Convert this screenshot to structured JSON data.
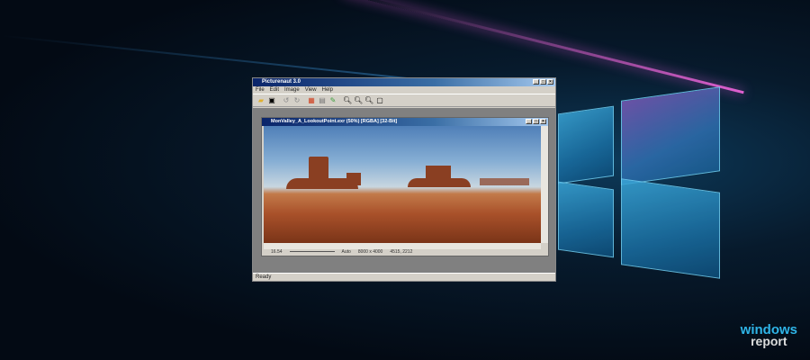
{
  "app": {
    "title": "Picturenaut 3.0",
    "menu": [
      "File",
      "Edit",
      "Image",
      "View",
      "Help"
    ],
    "toolbar": [
      "open-icon",
      "save-icon",
      "undo-icon",
      "redo-icon",
      "hdr-icon",
      "tonemap-icon",
      "color-icon",
      "zoom-in-icon",
      "zoom-out-icon",
      "zoom-fit-icon",
      "zoom-100-icon"
    ],
    "status": "Ready"
  },
  "document": {
    "title": "MonValley_A_LookoutPoint.exr (50%) [RGBA] [32-Bit]",
    "exposure": "16.54",
    "mode": "Auto",
    "size": "8000 x 4000",
    "cursor": "4515, 2212"
  },
  "branding": {
    "line1": "windows",
    "line2": "report"
  }
}
